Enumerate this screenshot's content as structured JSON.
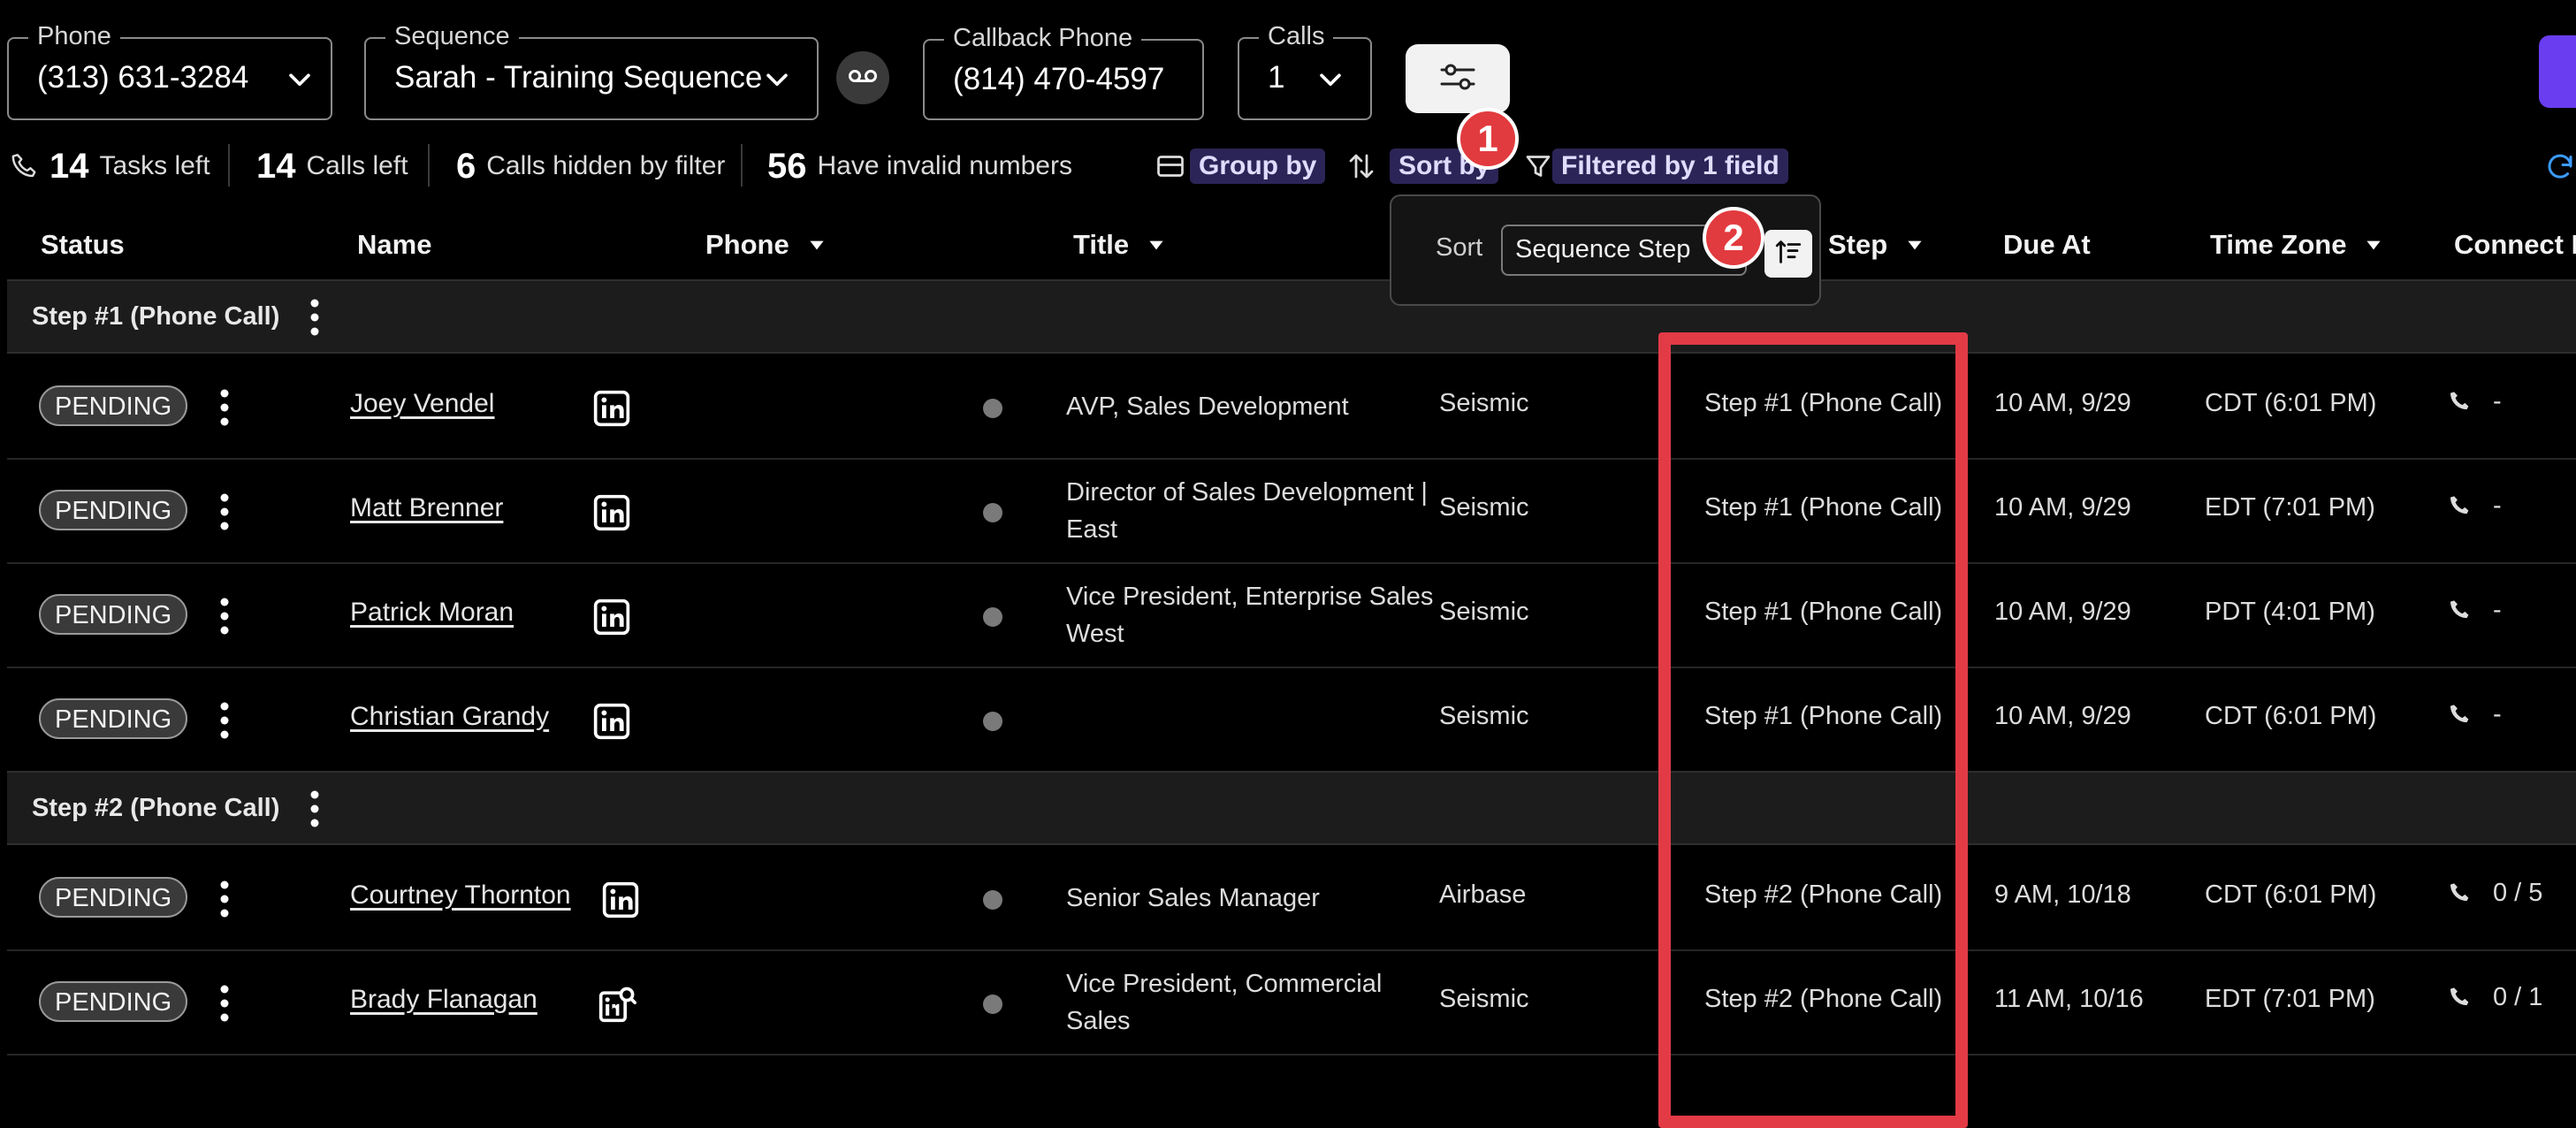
{
  "top": {
    "phone": {
      "legend": "Phone",
      "value": "(313) 631-3284"
    },
    "sequence": {
      "legend": "Sequence",
      "value": "Sarah - Training Sequence"
    },
    "callback": {
      "legend": "Callback Phone",
      "value": "(814) 470-4597"
    },
    "calls": {
      "legend": "Calls",
      "value": "1"
    }
  },
  "stats": {
    "tasks_left": {
      "num": "14",
      "label": "Tasks left"
    },
    "calls_left": {
      "num": "14",
      "label": "Calls left"
    },
    "hidden": {
      "num": "6",
      "label": "Calls hidden by filter"
    },
    "invalid": {
      "num": "56",
      "label": "Have invalid numbers"
    }
  },
  "toolbar": {
    "group_by": "Group by",
    "sort_by": "Sort by",
    "filtered": "Filtered by 1 field"
  },
  "badges": {
    "one": "1",
    "two": "2"
  },
  "sort_popover": {
    "label": "Sort",
    "selected": "Sequence Step"
  },
  "columns": {
    "status": "Status",
    "name": "Name",
    "phone": "Phone",
    "title": "Title",
    "step": "Step",
    "due_at": "Due At",
    "time_zone": "Time Zone",
    "connect_rate": "Connect Ra"
  },
  "groups": [
    {
      "label": "Step #1 (Phone Call)",
      "rows": [
        {
          "status": "PENDING",
          "name": "Joey Vendel",
          "title": "AVP, Sales Development",
          "company": "Seismic",
          "step": "Step #1 (Phone Call)",
          "due": "10 AM, 9/29",
          "tz": "CDT (6:01 PM)",
          "rate": "-",
          "li_search": false
        },
        {
          "status": "PENDING",
          "name": "Matt Brenner",
          "title": "Director of Sales Development | East",
          "company": "Seismic",
          "step": "Step #1 (Phone Call)",
          "due": "10 AM, 9/29",
          "tz": "EDT (7:01 PM)",
          "rate": "-",
          "li_search": false
        },
        {
          "status": "PENDING",
          "name": "Patrick Moran",
          "title": "Vice President, Enterprise Sales West",
          "company": "Seismic",
          "step": "Step #1 (Phone Call)",
          "due": "10 AM, 9/29",
          "tz": "PDT (4:01 PM)",
          "rate": "-",
          "li_search": false
        },
        {
          "status": "PENDING",
          "name": "Christian Grandy",
          "title": "",
          "company": "Seismic",
          "step": "Step #1 (Phone Call)",
          "due": "10 AM, 9/29",
          "tz": "CDT (6:01 PM)",
          "rate": "-",
          "li_search": false
        }
      ]
    },
    {
      "label": "Step #2 (Phone Call)",
      "rows": [
        {
          "status": "PENDING",
          "name": "Courtney Thornton",
          "title": "Senior Sales Manager",
          "company": "Airbase",
          "step": "Step #2 (Phone Call)",
          "due": "9 AM, 10/18",
          "tz": "CDT (6:01 PM)",
          "rate": "0 / 5",
          "li_search": false
        },
        {
          "status": "PENDING",
          "name": "Brady Flanagan",
          "title": "Vice President, Commercial Sales",
          "company": "Seismic",
          "step": "Step #2 (Phone Call)",
          "due": "11 AM, 10/16",
          "tz": "EDT (7:01 PM)",
          "rate": "0 / 1",
          "li_search": true
        }
      ]
    }
  ],
  "colors": {
    "accent_purple": "#6a3df0",
    "badge_red": "#e23b3f",
    "highlight_red": "#e23b46"
  }
}
